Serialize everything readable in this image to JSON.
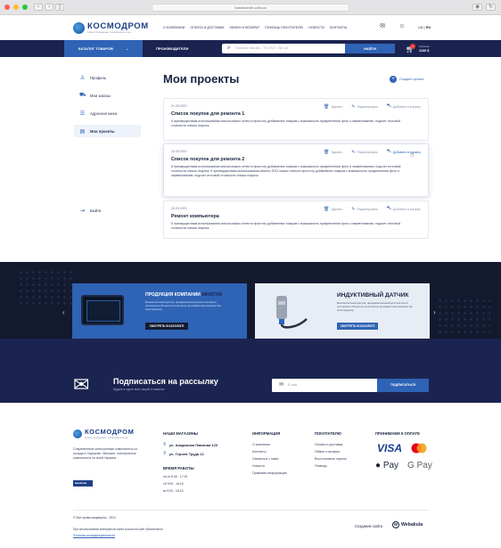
{
  "browser": {
    "url": "kosmodrom.com.ua",
    "dot_colors": [
      "#ff5f57",
      "#febc2e",
      "#28c840"
    ]
  },
  "header": {
    "logo_name": "КОСМОДРОМ",
    "logo_tagline": "электронные компоненты",
    "nav": [
      "О КОМПАНИИ",
      "ОПЛАТА И ДОСТАВКА",
      "ОБМЕН И ВОЗВРАТ",
      "ПОМОЩЬ ПОКУПАТЕЛЮ",
      "НОВОСТИ",
      "КОНТАКТЫ"
    ],
    "lang_ua": "UA",
    "lang_ru": "RU"
  },
  "bluebar": {
    "catalog": "КАТАЛОГ ТОВАРОВ",
    "producers": "ПРОИЗВОДИТЕЛИ",
    "search_placeholder": "Пример: Murata - TS-0S07-1W Lyt",
    "search_button": "НАЙТИ",
    "cart_count": "1",
    "cart_label": "Корзина",
    "cart_sum": "1100 $"
  },
  "sidebar": {
    "items": [
      {
        "label": "Профиль",
        "icon": "user-icon"
      },
      {
        "label": "Мои заказы",
        "icon": "truck-icon"
      },
      {
        "label": "Адресная книга",
        "icon": "address-book-icon"
      },
      {
        "label": "Мои проекты",
        "icon": "projects-icon",
        "active": true
      }
    ],
    "logout": "Выйти"
  },
  "main": {
    "title": "Мои проекты",
    "create_project": "Создать проект",
    "actions": {
      "delete": "Удалить",
      "edit": "Редактировать",
      "add_to_cart": "Добавить в корзину"
    },
    "projects": [
      {
        "date": "21.03.2021",
        "title": "Список покупок для ремонта 1",
        "desc": "К преимуществам использования списка можно отнести простоту добавления товаров с возможность прикрепления фото к наименованию; подсчет итоговой стоимости списка покупок"
      },
      {
        "date": "20.03.2021",
        "title": "Список покупок для ремонта 2",
        "desc": "К преимуществам использования списка можно отнести простоту добавления товаров с возможность прикрепления фото и наименованию; подсчет итоговой стоимости списка покупок. К преимуществам использования Анкеты 2021 можно отнести простоту добавления товаров с возможность прикрепления фото и наименованию; подсчет итоговой стоимости списка покупок"
      },
      {
        "date": "19.03.2021",
        "title": "Ремонт компьютера",
        "desc": "К преимуществам использования списка можно отнести простоту добавления товаров с возможность прикрепления фото к наименованию; подсчет итоговой стоимости списка покупок"
      }
    ]
  },
  "banners": {
    "b1_title_prefix": "ПРОДУКЦИЯ КОМПАНИИ",
    "b1_title_brand": "WINSTAR",
    "b1_desc": "Бесконтактный датчик, предназначенный для контроля положения объектов из металла (в рамках выполнения им конструкции)",
    "b1_button": "СМОТРЕТЬ В КАТАЛОГЕ",
    "b2_title": "ИНДУКТИВНЫЙ ДАТЧИК",
    "b2_desc": "Бесконтактный датчик, предназначенный для контроля положения объектов из металла (в рамках выполнения им конструкции)",
    "b2_button": "СМОТРЕТЬ В КАТАЛОГЕ"
  },
  "subscribe": {
    "title": "Подписаться на рассылку",
    "desc": "Будьте в курсе всех акций и новинок",
    "placeholder": "E-mail",
    "button": "ПОДПИСАТЬСЯ"
  },
  "footer": {
    "about": "Современные электронные компоненты со склада в Харькове. Магазин: электронные компоненты по всей Украине",
    "facebook": "facebook",
    "stores_title": "НАШИ МАГАЗИНЫ",
    "stores": [
      "ул. Академика Павлова 120",
      "ул. Героев Труда 12"
    ],
    "hours_title": "ВРЕМЯ РАБОТЫ",
    "hours": [
      "пн-пт 8:45 - 17:00",
      "сб 9:00 - 16:15",
      "вс 9:00 - 15:15"
    ],
    "info_title": "ИНФОРМАЦИЯ",
    "info": [
      "О компании",
      "Контакты",
      "Связаться с нами",
      "Новости",
      "Правовая информация"
    ],
    "buyer_title": "ПОКУПАТЕЛЮ",
    "buyer": [
      "Оплата и доставка",
      "Обмен и возврат",
      "Восстановить пароль",
      "Помощь"
    ],
    "pay_title": "ПРИНИМАЕМ К ОПЛАТЕ",
    "pay_visa": "VISA",
    "pay_apple": "Pay",
    "pay_google": "G Pay",
    "copyright": "© Все права защищены - 2021",
    "cookies": "При использовании материалов сайта ссылка на сайт обязательна!",
    "privacy": "Политика конфиденциальности",
    "made_by": "Создание сайта",
    "webakula": "Webakula"
  }
}
